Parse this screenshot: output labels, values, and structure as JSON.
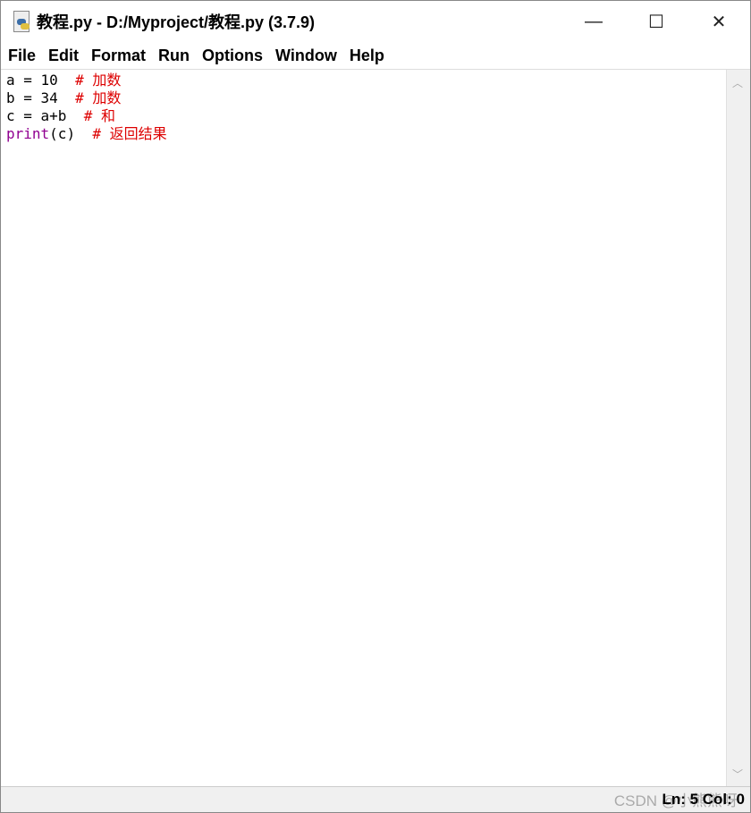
{
  "window": {
    "title": "教程.py - D:/Myproject/教程.py (3.7.9)",
    "icon": "python-file-icon",
    "controls": {
      "minimize": "—",
      "maximize": "☐",
      "close": "✕"
    }
  },
  "menubar": [
    "File",
    "Edit",
    "Format",
    "Run",
    "Options",
    "Window",
    "Help"
  ],
  "editor": {
    "lines": [
      {
        "code": "a = 10  ",
        "keyword": "",
        "comment": "# 加数"
      },
      {
        "code": "b = 34  ",
        "keyword": "",
        "comment": "# 加数"
      },
      {
        "code": "c = a+b  ",
        "keyword": "",
        "comment": "# 和"
      },
      {
        "code": "(c)  ",
        "keyword": "print",
        "comment": "# 返回结果"
      }
    ],
    "colors": {
      "keyword": "#900090",
      "comment": "#dd0000"
    }
  },
  "status": {
    "text": "Ln: 5  Col: 0"
  },
  "watermark": "CSDN @小熊熊呀"
}
